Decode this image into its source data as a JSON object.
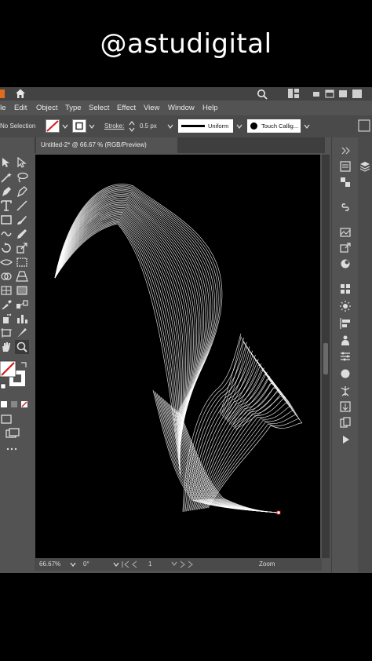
{
  "watermark": "@astudigital",
  "menu": [
    "lle",
    "Edit",
    "Object",
    "Type",
    "Select",
    "Effect",
    "View",
    "Window",
    "Help"
  ],
  "control_bar": {
    "selection": "No Selection",
    "stroke_label": "Stroke:",
    "stroke_value": "0.5 px",
    "profile": "Uniform",
    "brush": "Touch Callig..."
  },
  "document_tab": "Untitled-2* @ 66.67 % (RGB/Preview)",
  "status_bar": {
    "zoom": "66.67%",
    "rotation": "0°",
    "artboard": "1",
    "tool": "Zoom"
  },
  "colors": {
    "ui_bg": "#535353",
    "canvas_bg": "#000000",
    "artwork_stroke": "#ffffff",
    "app_accent": "#e06b1d",
    "swatch_red": "#d21c1c"
  }
}
